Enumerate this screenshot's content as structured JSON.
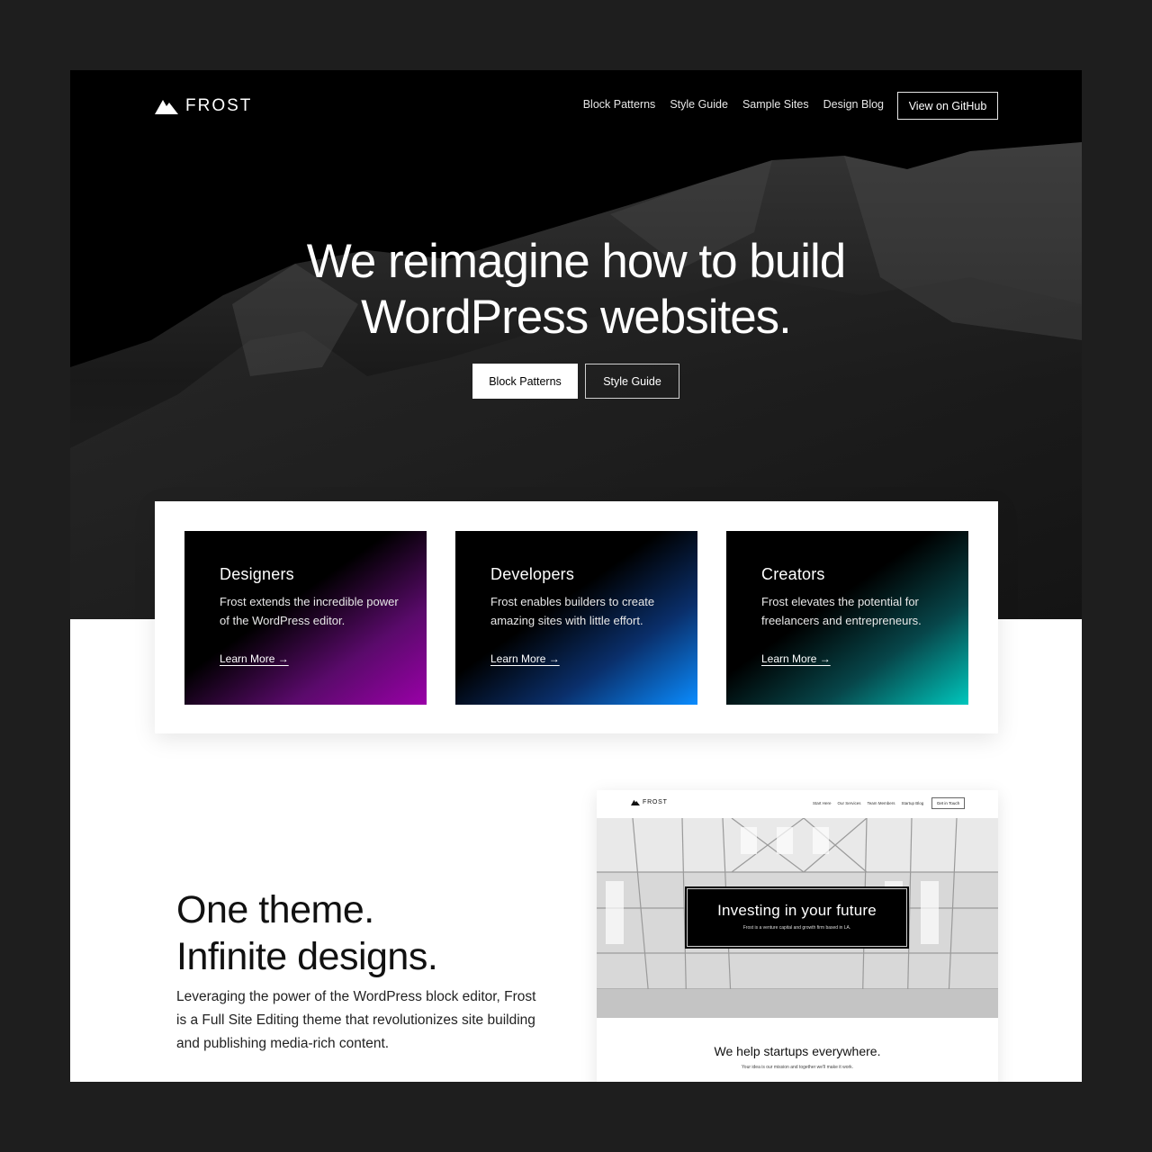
{
  "brand": {
    "name": "FROST"
  },
  "nav": {
    "links": [
      "Block Patterns",
      "Style Guide",
      "Sample Sites",
      "Design Blog"
    ],
    "cta": "View on GitHub"
  },
  "hero": {
    "title_line1": "We reimagine how to build",
    "title_line2": "WordPress websites.",
    "primary_button": "Block Patterns",
    "secondary_button": "Style Guide"
  },
  "cards": [
    {
      "title": "Designers",
      "text": "Frost extends the incredible power of the WordPress editor.",
      "link": "Learn More →",
      "accent": "#9a00a8"
    },
    {
      "title": "Developers",
      "text": "Frost enables builders to create amazing sites with little effort.",
      "link": "Learn More →",
      "accent": "#0a8cff"
    },
    {
      "title": "Creators",
      "text": "Frost elevates the potential for freelancers and entrepreneurs.",
      "link": "Learn More →",
      "accent": "#00c7bd"
    }
  ],
  "lower": {
    "title_line1": "One theme.",
    "title_line2": "Infinite designs.",
    "text": "Leveraging the power of the WordPress block editor, Frost is a Full Site Editing theme that revolutionizes site building and publishing media-rich content."
  },
  "mockup": {
    "brand": "FROST",
    "links": [
      "Start Here",
      "Our Services",
      "Team Members",
      "Startup Blog"
    ],
    "cta": "Get in Touch",
    "hero_title": "Investing in your future",
    "hero_sub": "Frost is a venture capital and growth firm based in LA.",
    "section_title": "We help startups everywhere.",
    "section_sub": "Your idea is our mission and together we'll make it work."
  },
  "colors": {
    "page_bg": "#1e1e1e",
    "hero_bg": "#000000",
    "surface": "#ffffff"
  }
}
